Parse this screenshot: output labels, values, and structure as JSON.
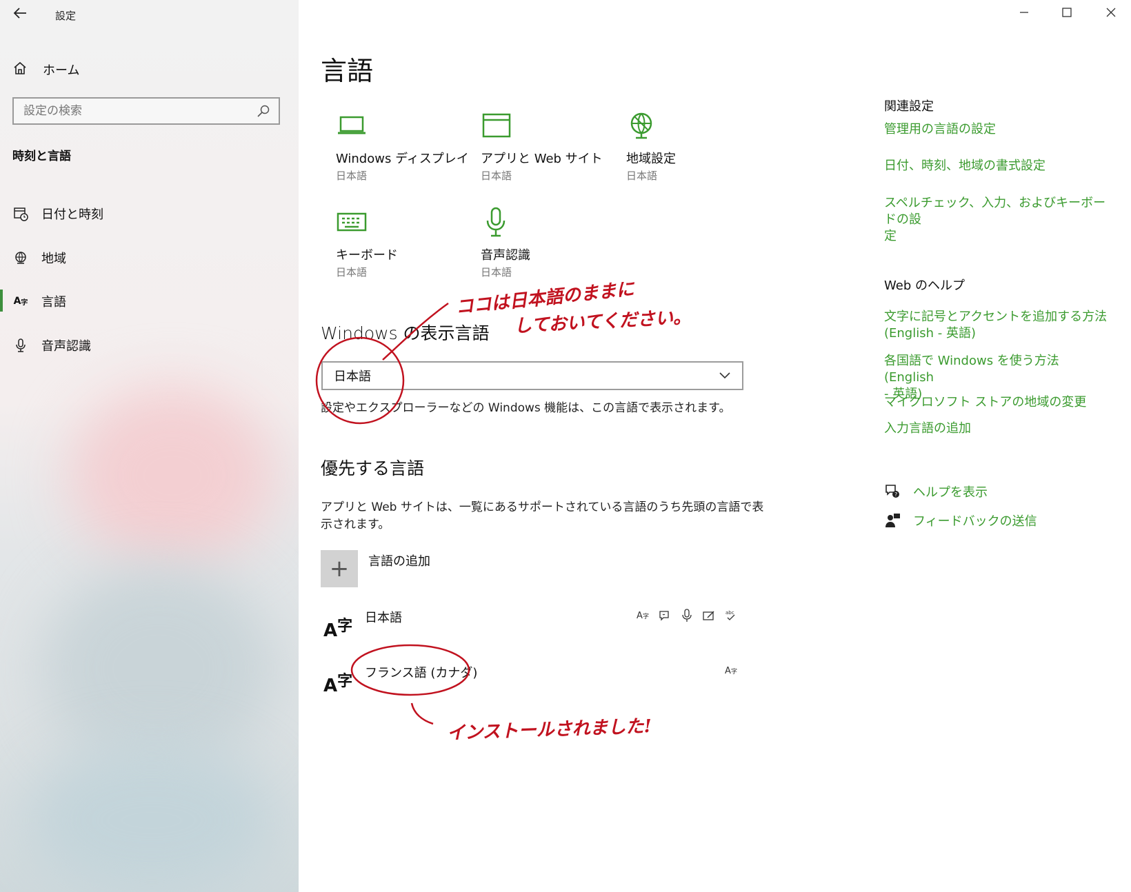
{
  "window": {
    "app_title": "設定",
    "controls": {
      "minimize": "—",
      "maximize": "☐",
      "close": "✕"
    }
  },
  "sidebar": {
    "home_label": "ホーム",
    "search_placeholder": "設定の検索",
    "section_title": "時刻と言語",
    "items": [
      {
        "label": "日付と時刻",
        "icon": "calendar-clock-icon"
      },
      {
        "label": "地域",
        "icon": "globe-icon"
      },
      {
        "label": "言語",
        "icon": "language-icon",
        "selected": true
      },
      {
        "label": "音声認識",
        "icon": "microphone-icon"
      }
    ]
  },
  "main": {
    "title": "言語",
    "tiles": [
      {
        "label": "Windows ディスプレイ",
        "sub": "日本語",
        "icon": "laptop-icon"
      },
      {
        "label": "アプリと Web サイト",
        "sub": "日本語",
        "icon": "window-icon"
      },
      {
        "label": "地域設定",
        "sub": "日本語",
        "icon": "region-globe-icon"
      },
      {
        "label": "キーボード",
        "sub": "日本語",
        "icon": "keyboard-icon"
      },
      {
        "label": "音声認識",
        "sub": "日本語",
        "icon": "microphone-icon"
      }
    ],
    "display_language": {
      "heading": "Windows の表示言語",
      "selected": "日本語",
      "description": "設定やエクスプローラーなどの Windows 機能は、この言語で表示されます。"
    },
    "preferred": {
      "heading": "優先する言語",
      "description_line1": "アプリと Web サイトは、一覧にあるサポートされている言語のうち先頭の言語で表",
      "description_line2": "示されます。",
      "add_label": "言語の追加",
      "add_glyph": "+",
      "languages": [
        {
          "name": "日本語",
          "icon_text": "A字",
          "features": [
            "display-language-icon",
            "text-to-speech-icon",
            "speech-recognition-icon",
            "handwriting-icon",
            "spellcheck-icon"
          ]
        },
        {
          "name": "フランス語 (カナダ)",
          "icon_text": "A字",
          "features": [
            "display-language-icon"
          ]
        }
      ]
    }
  },
  "related": {
    "heading": "関連設定",
    "links": [
      "管理用の言語の設定",
      "日付、時刻、地域の書式設定",
      "スペルチェック、入力、およびキーボードの設\n定"
    ],
    "web_help_heading": "Web のヘルプ",
    "help_links": [
      "文字に記号とアクセントを追加する方法\n(English - 英語)",
      "各国語で Windows を使う方法 (English\n- 英語)",
      "マイクロソフト ストアの地域の変更",
      "入力言語の追加"
    ],
    "get_help": "ヘルプを表示",
    "feedback": "フィードバックの送信",
    "accent_color": "#3b9b2f"
  },
  "annotations": {
    "note1_line1": "ココは日本語のままに",
    "note1_line2": "しておいてください。",
    "note2": "インストールされました!",
    "color": "#c1121f"
  }
}
